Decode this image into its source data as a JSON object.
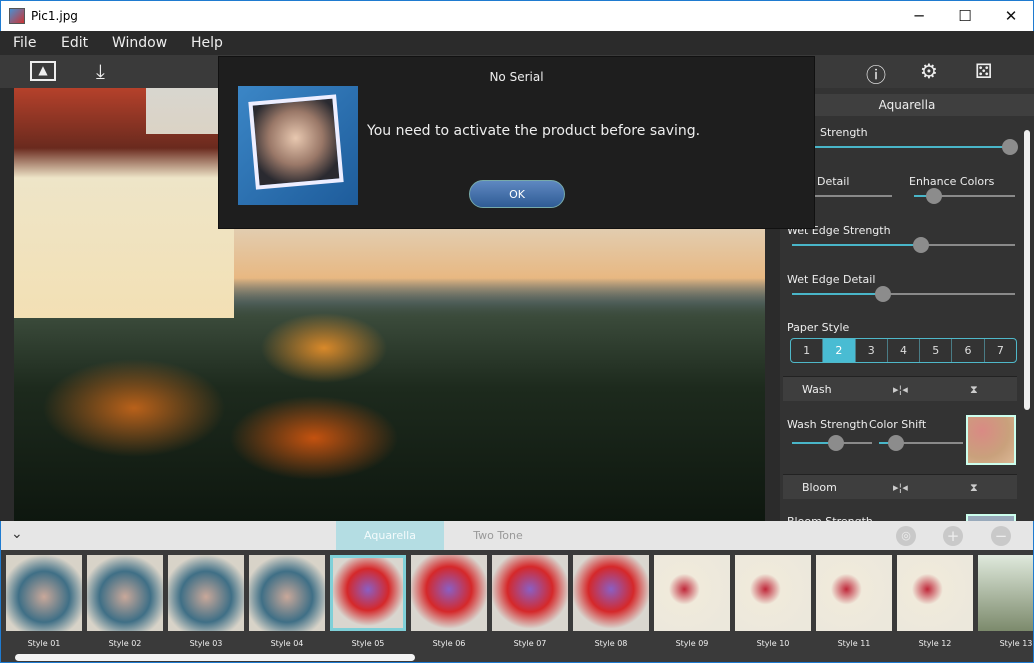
{
  "window": {
    "title": "Pic1.jpg",
    "minimize": "─",
    "maximize": "☐",
    "close": "✕"
  },
  "menu": [
    "File",
    "Edit",
    "Window",
    "Help"
  ],
  "toolbar": {
    "icons": [
      "open-image-icon",
      "save-download-icon",
      "info-icon",
      "settings-icon",
      "random-dice-icon"
    ]
  },
  "dialog": {
    "title": "No Serial",
    "message": "You need to activate the product before saving.",
    "ok": "OK"
  },
  "panel": {
    "title": "Aquarella",
    "sliders": [
      {
        "label": "Strength",
        "value": 1.0
      },
      {
        "label": "Detail",
        "value": 0.15
      },
      {
        "label": "Enhance Colors",
        "value": 0.2
      },
      {
        "label": "Wet Edge Strength",
        "value": 0.58
      },
      {
        "label": "Wet Edge Detail",
        "value": 0.41
      },
      {
        "label": "Wash Strength",
        "value": 0.55
      },
      {
        "label": "Color Shift",
        "value": 0.2
      }
    ],
    "paper_style": {
      "label": "Paper Style",
      "options": [
        "1",
        "2",
        "3",
        "4",
        "5",
        "6",
        "7"
      ],
      "selected": "2"
    },
    "sections": [
      "Wash",
      "Bloom"
    ],
    "bloom_strength": "Bloom Strength"
  },
  "strip": {
    "tabs": [
      "Aquarella",
      "Two Tone"
    ],
    "active_tab": "Aquarella",
    "styles": [
      "Style 01",
      "Style 02",
      "Style 03",
      "Style 04",
      "Style 05",
      "Style 06",
      "Style 07",
      "Style 08",
      "Style 09",
      "Style 10",
      "Style 11",
      "Style 12",
      "Style 13"
    ],
    "selected": "Style 05"
  },
  "colors": {
    "accent": "#49b6c9",
    "panel": "#333333",
    "dialog": "#1e1e1e"
  }
}
